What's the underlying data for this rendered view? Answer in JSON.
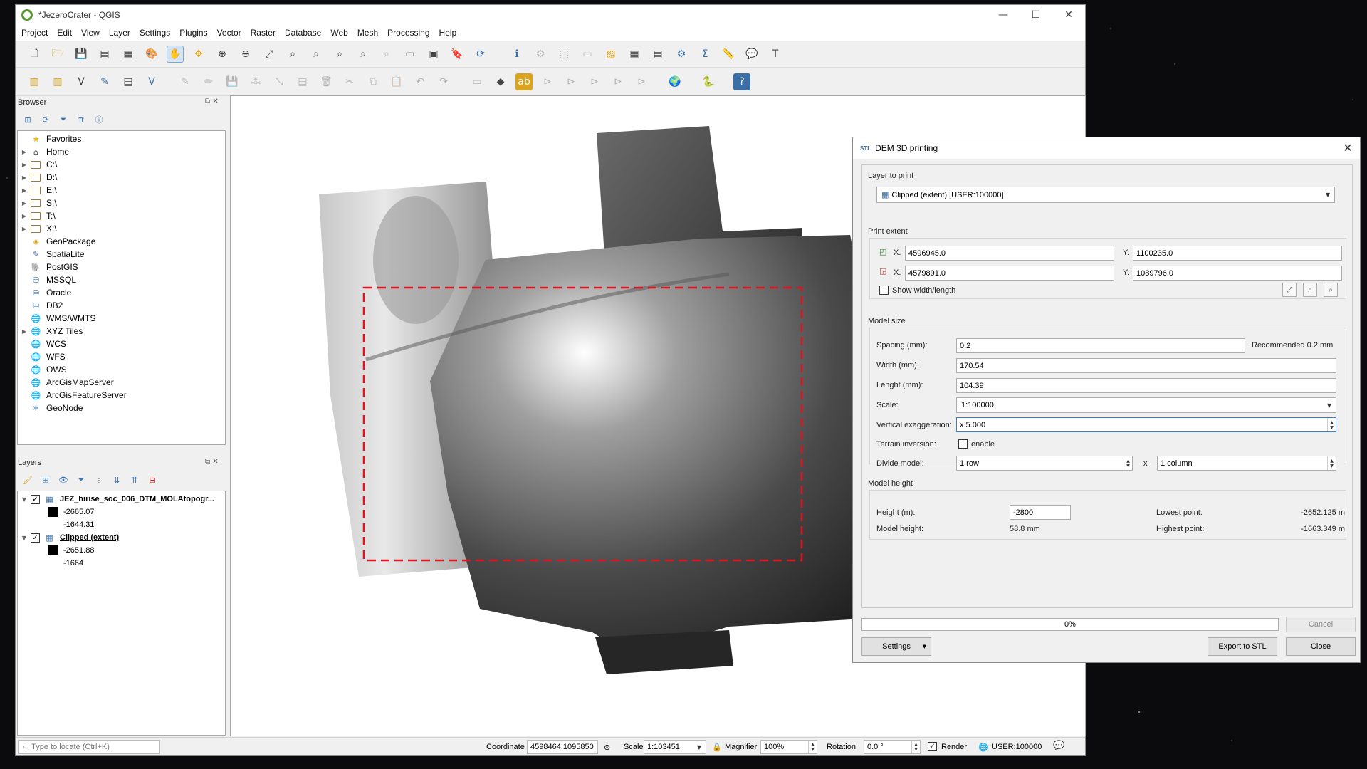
{
  "window": {
    "title": "*JezeroCrater - QGIS",
    "min": "—",
    "max": "☐",
    "close": "✕"
  },
  "menu": [
    "Project",
    "Edit",
    "View",
    "Layer",
    "Settings",
    "Plugins",
    "Vector",
    "Raster",
    "Database",
    "Web",
    "Mesh",
    "Processing",
    "Help"
  ],
  "browser": {
    "title": "Browser",
    "items": [
      {
        "label": "Favorites",
        "icon": "star-icon",
        "arrow": ""
      },
      {
        "label": "Home",
        "icon": "home-icon",
        "arrow": "▶"
      },
      {
        "label": "C:\\",
        "icon": "folder-icon",
        "arrow": "▶"
      },
      {
        "label": "D:\\",
        "icon": "folder-icon",
        "arrow": "▶"
      },
      {
        "label": "E:\\",
        "icon": "folder-icon",
        "arrow": "▶"
      },
      {
        "label": "S:\\",
        "icon": "folder-icon",
        "arrow": "▶"
      },
      {
        "label": "T:\\",
        "icon": "folder-icon",
        "arrow": "▶"
      },
      {
        "label": "X:\\",
        "icon": "folder-icon",
        "arrow": "▶"
      },
      {
        "label": "GeoPackage",
        "icon": "geopackage-icon",
        "arrow": ""
      },
      {
        "label": "SpatiaLite",
        "icon": "feather-icon",
        "arrow": ""
      },
      {
        "label": "PostGIS",
        "icon": "elephant-icon",
        "arrow": ""
      },
      {
        "label": "MSSQL",
        "icon": "database-icon",
        "arrow": ""
      },
      {
        "label": "Oracle",
        "icon": "database-icon",
        "arrow": ""
      },
      {
        "label": "DB2",
        "icon": "database-icon",
        "arrow": ""
      },
      {
        "label": "WMS/WMTS",
        "icon": "globe-icon",
        "arrow": ""
      },
      {
        "label": "XYZ Tiles",
        "icon": "globe-icon",
        "arrow": "▶"
      },
      {
        "label": "WCS",
        "icon": "globe-icon",
        "arrow": ""
      },
      {
        "label": "WFS",
        "icon": "globe-icon",
        "arrow": ""
      },
      {
        "label": "OWS",
        "icon": "globe-icon",
        "arrow": ""
      },
      {
        "label": "ArcGisMapServer",
        "icon": "globe-icon",
        "arrow": ""
      },
      {
        "label": "ArcGisFeatureServer",
        "icon": "globe-icon",
        "arrow": ""
      },
      {
        "label": "GeoNode",
        "icon": "geonode-icon",
        "arrow": ""
      }
    ]
  },
  "layers": {
    "title": "Layers",
    "items": [
      {
        "name": "JEZ_hirise_soc_006_DTM_MOLAtopogr...",
        "max": "-2665.07",
        "min": "-1644.31"
      },
      {
        "name": "Clipped (extent)",
        "max": "-2651.88",
        "min": "-1664"
      }
    ]
  },
  "statusbar": {
    "locate_placeholder": "Type to locate (Ctrl+K)",
    "coordinate_label": "Coordinate",
    "coordinate": "4598464,1095850",
    "scale_label": "Scale",
    "scale": "1:103451",
    "magnifier_label": "Magnifier",
    "magnifier": "100%",
    "rotation_label": "Rotation",
    "rotation": "0.0 °",
    "render_label": "Render",
    "crs": "USER:100000"
  },
  "dialog": {
    "title": "DEM 3D printing",
    "close": "✕",
    "layer_section": "Layer to print",
    "layer": "Clipped (extent) [USER:100000]",
    "extent_section": "Print extent",
    "x1_label": "X:",
    "x1": "4596945.0",
    "y1_label": "Y:",
    "y1": "1100235.0",
    "x2_label": "X:",
    "x2": "4579891.0",
    "y2_label": "Y:",
    "y2": "1089796.0",
    "show_wl": "Show width/length",
    "model_section": "Model size",
    "spacing_label": "Spacing (mm):",
    "spacing": "0.2",
    "recommended": "Recommended  0.2 mm",
    "width_label": "Width (mm):",
    "width": "170.54",
    "length_label": "Lenght (mm):",
    "length": "104.39",
    "scale_label": "Scale:",
    "scale": "1:100000",
    "vexag_label": "Vertical exaggeration:",
    "vexag": "x 5.000",
    "terrain_label": "Terrain inversion:",
    "terrain_enable": "enable",
    "divide_label": "Divide model:",
    "rows": "1 row",
    "x_sep": "x",
    "cols": "1 column",
    "height_section": "Model height",
    "height_label": "Height (m):",
    "height": "-2800",
    "model_height_label": "Model height:",
    "model_height": "58.8 mm",
    "lowest_label": "Lowest point:",
    "lowest": "-2652.125 m",
    "highest_label": "Highest point:",
    "highest": "-1663.349 m",
    "progress": "0%",
    "progress_value": 0,
    "cancel": "Cancel",
    "settings": "Settings",
    "export": "Export to STL",
    "close_btn": "Close"
  },
  "colors": {
    "accent": "#3b7bd4",
    "extent_rect": "#e0141e",
    "qgis_green": "#589632"
  }
}
